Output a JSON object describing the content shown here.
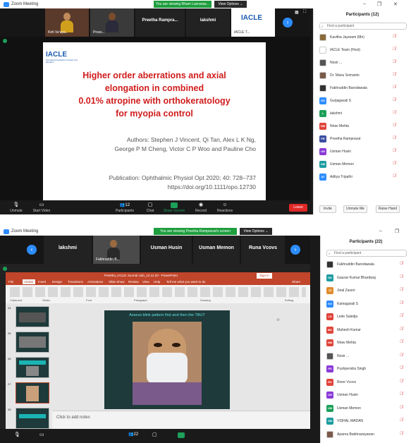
{
  "window1": {
    "title": "Zoom Meeting",
    "banner": "You are viewing Rham Lavranas...",
    "view_options": "View Options ⌄",
    "tiles": [
      {
        "name": "Kirti Ve'aya.."
      },
      {
        "name": "Prsss..."
      },
      {
        "name": "Preetha Rampra..."
      },
      {
        "name": "lakshmi"
      },
      {
        "name": "IACLE T..."
      }
    ],
    "slide": {
      "logo": "IACLE",
      "logo_sub": "International Association of Contact Lens Educators",
      "title_lines": [
        "Higher order aberrations and axial",
        "elongation in combined",
        "0.01% atropine with orthokeratology",
        "for myopia control"
      ],
      "authors_lines": [
        "Authors: Stephen J Vincent, Qi Tan, Alex L K Ng,",
        "George P M Cheng, Victor C P Woo and Pauline Cho"
      ],
      "pub_lines": [
        "Publication: Ophthalmic Physiol Opt 2020; 40: 728–737",
        "https://doi.org/10.1111/opo.12730"
      ]
    },
    "toolbar": {
      "items": [
        {
          "label": "Unmute",
          "icon": "mic-icon"
        },
        {
          "label": "Start Video",
          "icon": "video-icon"
        },
        {
          "label": "Participants",
          "icon": "participants-icon",
          "count": "12"
        },
        {
          "label": "Chat",
          "icon": "chat-icon"
        },
        {
          "label": "Share Screen",
          "icon": "share-icon"
        },
        {
          "label": "Record",
          "icon": "record-icon"
        },
        {
          "label": "Reactions",
          "icon": "reactions-icon"
        }
      ],
      "leave": "Leave"
    },
    "panel": {
      "title": "Participants (12)",
      "search_placeholder": "Find a participant",
      "participants": [
        {
          "name": "Kavitha Jayaram (Me)",
          "initials": "",
          "color": "#8a6a3a"
        },
        {
          "name": "IACLE Team (Host)",
          "initials": "",
          "color": "#ffffff"
        },
        {
          "name": "Nosir ...",
          "initials": "",
          "color": "#555555"
        },
        {
          "name": "Dr. Manu Somanto",
          "initials": "",
          "color": "#7a5a4a"
        },
        {
          "name": "Fakhruddin Barodawala",
          "initials": "",
          "color": "#333333"
        },
        {
          "name": "Gurjagavali S",
          "initials": "GS",
          "color": "#2d8cff"
        },
        {
          "name": "lakshmi",
          "initials": "L",
          "color": "#1ca05a"
        },
        {
          "name": "Nirav Mehta",
          "initials": "NM",
          "color": "#e0443a"
        },
        {
          "name": "Preetha Rampravat",
          "initials": "PR",
          "color": "#3a4ea0"
        },
        {
          "name": "Usman Husin",
          "initials": "UH",
          "color": "#8a3ad8"
        },
        {
          "name": "Usman Memon",
          "initials": "UM",
          "color": "#1c9ca0"
        },
        {
          "name": "Aditya Tripathi",
          "initials": "AT",
          "color": "#2d8cff"
        }
      ],
      "buttons": [
        "Invite",
        "Unmute Me",
        "Raise Hand"
      ]
    }
  },
  "window2": {
    "title": "Zoom Meeting",
    "banner": "You are viewing Preetha Rampravat's screen",
    "view_options": "View Options ⌄",
    "tiles": [
      {
        "name": "lakshmi"
      },
      {
        "name": "Fakhruddin B..."
      },
      {
        "name": "Usman Husin"
      },
      {
        "name": "Usman Memon"
      },
      {
        "name": "Runa Vcovs"
      }
    ],
    "ppt": {
      "title": "Preetha_IACLE Journal club_12.12.20 - PowerPoint",
      "menus": [
        "File",
        "Home",
        "Insert",
        "Design",
        "Transitions",
        "Animations",
        "Slide Show",
        "Review",
        "View",
        "Help"
      ],
      "search": "Tell me what you want to do",
      "sign_in": "Sign in",
      "share": "Share",
      "groups": [
        "Clipboard",
        "Slides",
        "Font",
        "Paragraph",
        "Drawing",
        "Editing"
      ],
      "slide_heading": "Assess blink pattern first and then the TBUT",
      "notes": "Click to add notes",
      "thumb_numbers": [
        "24",
        "25",
        "26",
        "27",
        "28"
      ]
    },
    "toolbar": {
      "participants_count": "22"
    },
    "panel": {
      "title": "Participants (22)",
      "search_placeholder": "Find a participant",
      "participants": [
        {
          "name": "Fakhruddin Barodawala",
          "initials": "",
          "color": "#333333"
        },
        {
          "name": "Gaurav Kumar Bhardwaj",
          "initials": "GK",
          "color": "#1c9ca0"
        },
        {
          "name": "Jinal Zaveri",
          "initials": "JZ",
          "color": "#e08a2a"
        },
        {
          "name": "Kamagarali S",
          "initials": "KS",
          "color": "#2d8cff"
        },
        {
          "name": "Lede Saledja",
          "initials": "LS",
          "color": "#e0443a"
        },
        {
          "name": "Mahesh Kumar",
          "initials": "MK",
          "color": "#e0443a"
        },
        {
          "name": "Nirav Mehta",
          "initials": "NM",
          "color": "#e0443a"
        },
        {
          "name": "Nosir ...",
          "initials": "",
          "color": "#555555"
        },
        {
          "name": "Pushpendra Singh",
          "initials": "PS",
          "color": "#8a3ad8"
        },
        {
          "name": "Rone Vcovs",
          "initials": "RV",
          "color": "#e0443a"
        },
        {
          "name": "Usman Husin",
          "initials": "UH",
          "color": "#8a3ad8"
        },
        {
          "name": "Usman Memon",
          "initials": "UM",
          "color": "#1ca05a"
        },
        {
          "name": "VISHAL MADAN",
          "initials": "VM",
          "color": "#1c9ca0"
        },
        {
          "name": "Aparna Badrinarayanan",
          "initials": "",
          "color": "#7a5a4a"
        }
      ]
    }
  }
}
